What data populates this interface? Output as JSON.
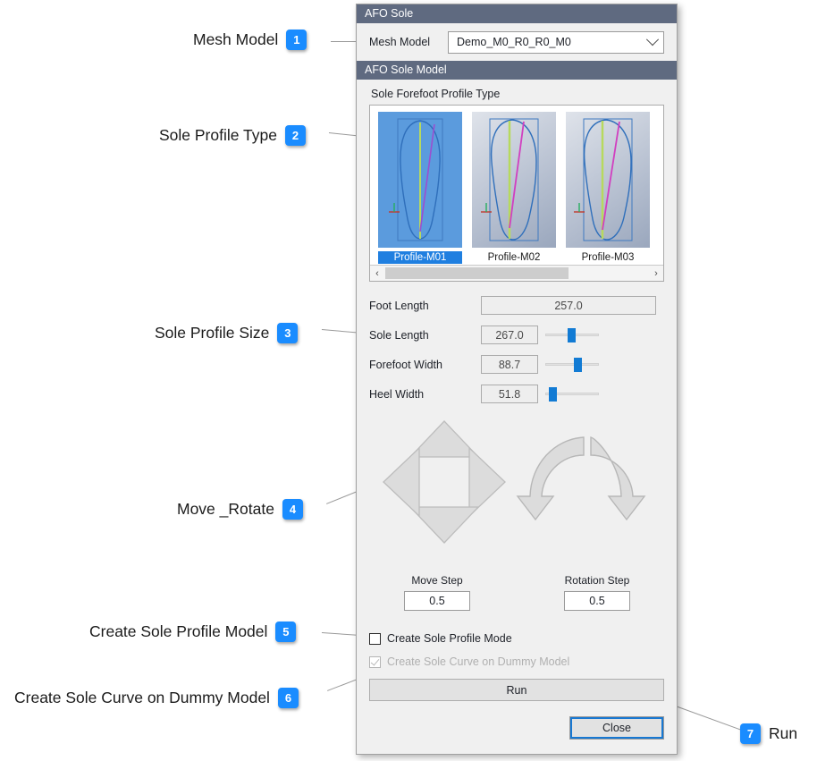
{
  "annotations": [
    {
      "n": "1",
      "label": "Mesh Model"
    },
    {
      "n": "2",
      "label": "Sole Profile Type"
    },
    {
      "n": "3",
      "label": "Sole Profile Size"
    },
    {
      "n": "4",
      "label": "Move _Rotate"
    },
    {
      "n": "5",
      "label": "Create Sole Profile Model"
    },
    {
      "n": "6",
      "label": "Create Sole Curve on Dummy Model"
    },
    {
      "n": "7",
      "label": "Run"
    }
  ],
  "dialog": {
    "group1_title": "AFO Sole",
    "mesh_model_label": "Mesh Model",
    "mesh_model_value": "Demo_M0_R0_R0_M0",
    "group2_title": "AFO Sole Model",
    "profile_type_title": "Sole Forefoot Profile Type",
    "profiles": [
      {
        "caption": "Profile-M01",
        "selected": true
      },
      {
        "caption": "Profile-M02",
        "selected": false
      },
      {
        "caption": "Profile-M03",
        "selected": false
      }
    ],
    "scroll_left_icon": "‹",
    "scroll_right_icon": "›",
    "sizes": [
      {
        "label": "Foot Length",
        "value": "257.0",
        "has_slider": false,
        "slider_pct": 0
      },
      {
        "label": "Sole Length",
        "value": "267.0",
        "has_slider": true,
        "slider_pct": 42
      },
      {
        "label": "Forefoot Width",
        "value": "88.7",
        "has_slider": true,
        "slider_pct": 53
      },
      {
        "label": "Heel Width",
        "value": "51.8",
        "has_slider": true,
        "slider_pct": 7
      }
    ],
    "move_step_label": "Move Step",
    "move_step_value": "0.5",
    "rotation_step_label": "Rotation Step",
    "rotation_step_value": "0.5",
    "checkbox1_label": "Create Sole Profile Mode",
    "checkbox2_label": "Create Sole Curve on Dummy Model",
    "run_label": "Run",
    "close_label": "Close"
  },
  "colors": {
    "header_bar": "#5f6a80",
    "badge_blue": "#1a8cff",
    "selection_blue": "#1f7fe0",
    "slider_blue": "#127bd4",
    "focus_ring": "#1878d2"
  }
}
